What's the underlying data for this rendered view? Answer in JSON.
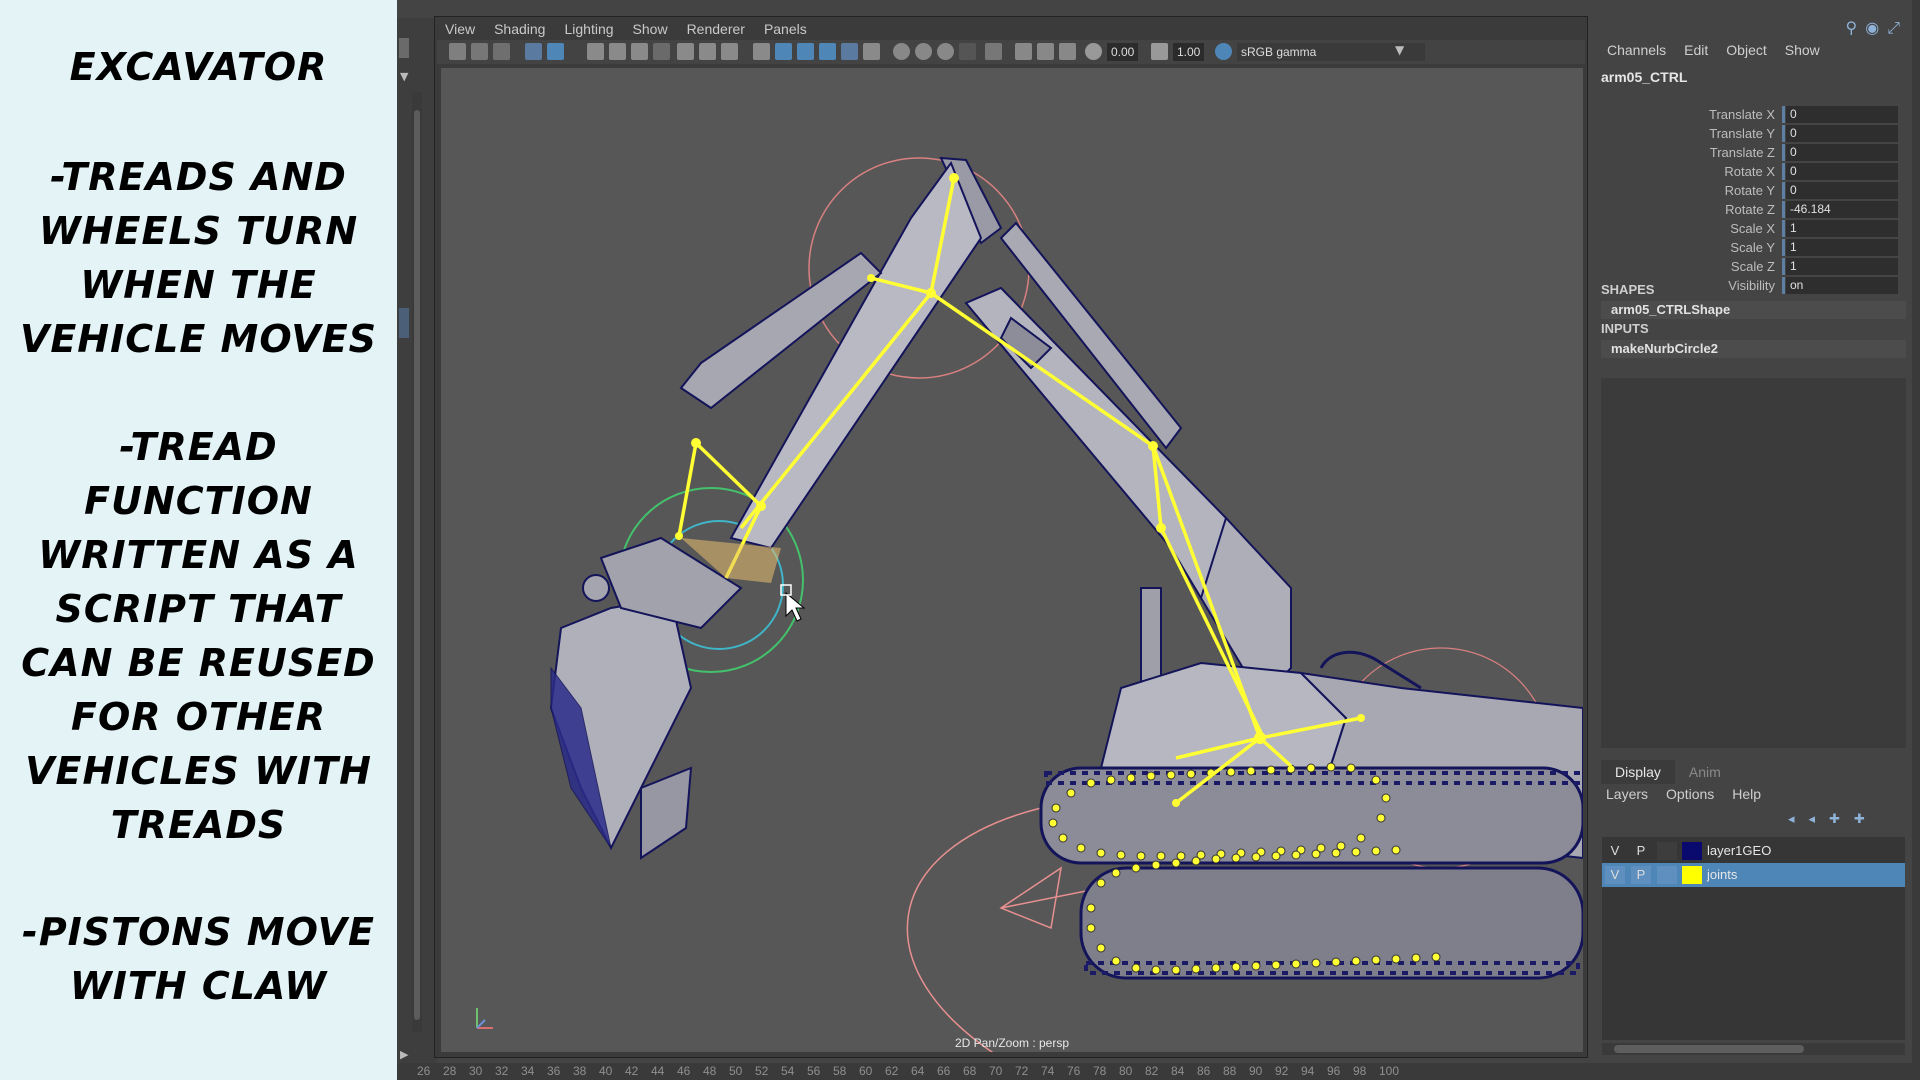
{
  "notes": {
    "title": "Excavator",
    "point1": "-Treads and wheels turn when the vehicle moves",
    "point2": "-Tread function written as a script that can be reused for other vehicles with treads",
    "point3": "-Pistons move with claw"
  },
  "viewport": {
    "menu": [
      "View",
      "Shading",
      "Lighting",
      "Show",
      "Renderer",
      "Panels"
    ],
    "toolbar": {
      "value_a": "0.00",
      "value_b": "1.00",
      "color_space": "sRGB gamma"
    },
    "camera_label": "2D Pan/Zoom : persp"
  },
  "channel_box": {
    "menu": [
      "Channels",
      "Edit",
      "Object",
      "Show"
    ],
    "node_name": "arm05_CTRL",
    "attributes": [
      {
        "name": "Translate X",
        "value": "0"
      },
      {
        "name": "Translate Y",
        "value": "0"
      },
      {
        "name": "Translate Z",
        "value": "0"
      },
      {
        "name": "Rotate X",
        "value": "0"
      },
      {
        "name": "Rotate Y",
        "value": "0"
      },
      {
        "name": "Rotate Z",
        "value": "-46.184"
      },
      {
        "name": "Scale X",
        "value": "1"
      },
      {
        "name": "Scale Y",
        "value": "1"
      },
      {
        "name": "Scale Z",
        "value": "1"
      },
      {
        "name": "Visibility",
        "value": "on"
      }
    ],
    "shapes_header": "SHAPES",
    "shape_name": "arm05_CTRLShape",
    "inputs_header": "INPUTS",
    "input_name": "makeNurbCircle2"
  },
  "layer_editor": {
    "tabs": [
      "Display",
      "Anim"
    ],
    "menu": [
      "Layers",
      "Options",
      "Help"
    ],
    "layers": [
      {
        "v": "V",
        "p": "P",
        "color": "#0a0a6e",
        "name": "layer1GEO"
      },
      {
        "v": "V",
        "p": "P",
        "color": "#ffff00",
        "name": "joints"
      }
    ]
  },
  "timeline": {
    "ticks": [
      "26",
      "28",
      "30",
      "32",
      "34",
      "36",
      "38",
      "40",
      "42",
      "44",
      "46",
      "48",
      "50",
      "52",
      "54",
      "56",
      "58",
      "60",
      "62",
      "64",
      "66",
      "68",
      "70",
      "72",
      "74",
      "76",
      "78",
      "80",
      "82",
      "84",
      "86",
      "88",
      "90",
      "92",
      "94",
      "96",
      "98",
      "100"
    ]
  },
  "colors": {
    "notes_bg": "#e3f3f6",
    "joint_yellow": "#ffff33",
    "wire_navy": "#14145a",
    "selection_blue": "#4f86b8"
  }
}
